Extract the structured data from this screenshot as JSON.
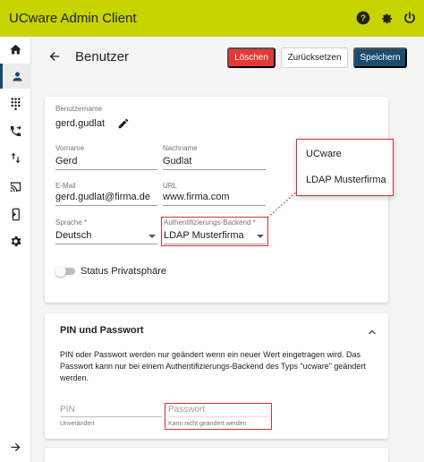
{
  "app": {
    "title": "UCware Admin Client"
  },
  "topbar": {
    "icons": [
      "help-icon",
      "settings-gear-icon",
      "power-icon"
    ]
  },
  "sidebar": {
    "items": [
      {
        "icon": "home-icon"
      },
      {
        "icon": "user-icon",
        "active": true
      },
      {
        "icon": "dialpad-icon"
      },
      {
        "icon": "phone-forward-icon"
      },
      {
        "icon": "swap-vertical-icon"
      },
      {
        "icon": "cast-icon"
      },
      {
        "icon": "phone-login-icon"
      },
      {
        "icon": "settings-icon"
      }
    ],
    "expand_icon": "arrow-right-icon"
  },
  "page": {
    "title": "Benutzer",
    "back_icon": "arrow-back-icon"
  },
  "actions": {
    "delete": "Löschen",
    "reset": "Zurücksetzen",
    "save": "Speichern"
  },
  "colors": {
    "brand": "#c8d400",
    "primary": "#1a4c6e",
    "danger": "#e53935",
    "highlight": "#d32f2f"
  },
  "user": {
    "username": {
      "label": "Benutzername",
      "value": "gerd.gudlat"
    },
    "firstname": {
      "label": "Vorname",
      "value": "Gerd"
    },
    "lastname": {
      "label": "Nachname",
      "value": "Gudlat"
    },
    "email": {
      "label": "E-Mail",
      "value": "gerd.gudlat@firma.de"
    },
    "url": {
      "label": "URL",
      "value": "www.firma.com"
    },
    "language": {
      "label": "Sprache *",
      "value": "Deutsch"
    },
    "auth_backend": {
      "label": "Authentifizierungs-Backend *",
      "value": "LDAP Musterfirma"
    },
    "privacy": {
      "label": "Status Privatsphäre",
      "enabled": false
    }
  },
  "auth_dropdown": {
    "options": [
      "UCware",
      "LDAP Musterfirma"
    ]
  },
  "pin_section": {
    "title": "PIN und Passwort",
    "description": "PIN oder Passwort werden nur geändert wenn ein neuer Wert eingetragen wird. Das Passwort kann nur bei einem Authentifizierungs-Backend des Typs \"ucware\" geändert werden.",
    "pin": {
      "placeholder": "PIN",
      "hint": "Unverändert"
    },
    "password": {
      "placeholder": "Passwort",
      "hint": "Kann nicht geändert werden"
    }
  }
}
